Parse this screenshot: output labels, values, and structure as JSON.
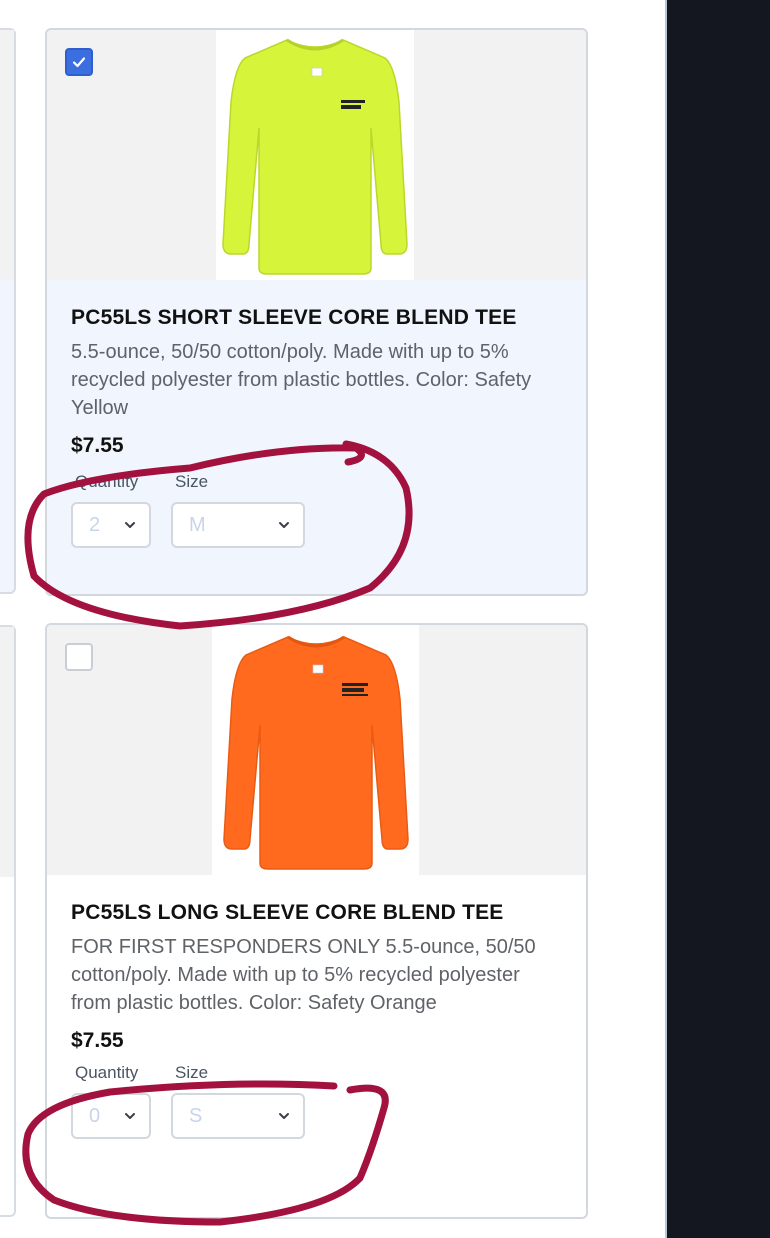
{
  "products": [
    {
      "title": "PC55LS SHORT SLEEVE CORE BLEND TEE",
      "description": "5.5-ounce, 50/50 cotton/poly. Made with up to 5% recycled polyester from plastic bottles. Color: Safety Yellow",
      "price": "$7.55",
      "checked": true,
      "shirt_color": "#d6f53a",
      "quantity_label": "Quantity",
      "quantity_value": "2",
      "size_label": "Size",
      "size_value": "M"
    },
    {
      "title": "PC55LS LONG SLEEVE CORE BLEND TEE",
      "description": "FOR FIRST RESPONDERS ONLY 5.5-ounce, 50/50 cotton/poly. Made with up to 5% recycled polyester from plastic bottles. Color: Safety Orange",
      "price": "$7.55",
      "checked": false,
      "shirt_color": "#ff6a1f",
      "quantity_label": "Quantity",
      "quantity_value": "0",
      "size_label": "Size",
      "size_value": "S"
    }
  ],
  "colors": {
    "accent": "#3b6fe0",
    "selected_card_bg": "#f1f5fd",
    "annotation": "#a3123f",
    "dark_panel": "#141620"
  },
  "icons": {
    "checkbox_check": "check-icon",
    "select_arrow": "chevron-down-icon"
  }
}
